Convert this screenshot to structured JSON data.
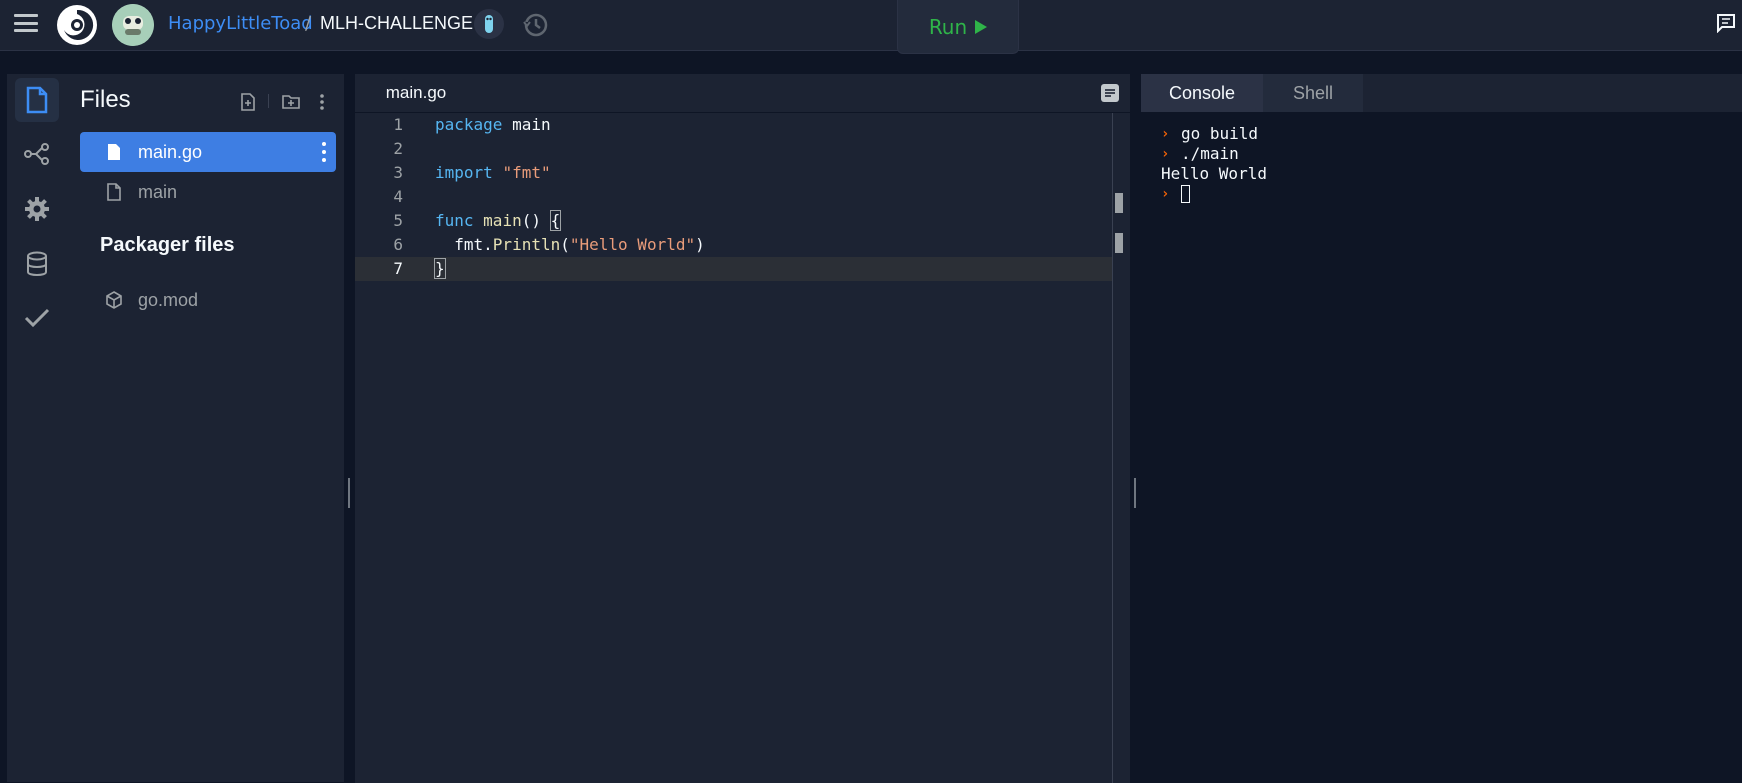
{
  "topbar": {
    "username": "HappyLittleToad",
    "separator": "/",
    "repl_name": "MLH-CHALLENGE",
    "run_label": "Run"
  },
  "sidebar": {
    "icons": [
      "files-icon",
      "version-control-icon",
      "settings-icon",
      "database-icon",
      "unit-tests-icon"
    ]
  },
  "files_panel": {
    "title": "Files",
    "files": [
      {
        "name": "main.go",
        "active": true
      },
      {
        "name": "main",
        "active": false
      }
    ],
    "packager_title": "Packager files",
    "packager_files": [
      {
        "name": "go.mod"
      }
    ]
  },
  "editor": {
    "tab_label": "main.go",
    "lines": [
      {
        "n": "1",
        "code": "package main"
      },
      {
        "n": "2",
        "code": ""
      },
      {
        "n": "3",
        "code": "import \"fmt\""
      },
      {
        "n": "4",
        "code": ""
      },
      {
        "n": "5",
        "code": "func main() {"
      },
      {
        "n": "6",
        "code": "  fmt.Println(\"Hello World\")"
      },
      {
        "n": "7",
        "code": "}"
      }
    ],
    "current_line": 7
  },
  "console": {
    "tabs": [
      "Console",
      "Shell"
    ],
    "active_tab": "Console",
    "output": [
      {
        "prompt": true,
        "text": "go build"
      },
      {
        "prompt": true,
        "text": "./main"
      },
      {
        "prompt": false,
        "text": "Hello World"
      },
      {
        "prompt": true,
        "text": ""
      }
    ]
  },
  "colors": {
    "accent": "#3e7ee3",
    "run": "#2fb449",
    "prompt": "#f26207",
    "link": "#3d8df5"
  }
}
